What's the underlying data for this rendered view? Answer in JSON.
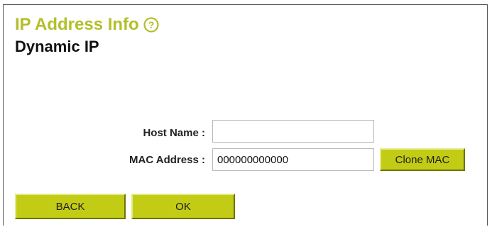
{
  "header": {
    "title": "IP Address Info",
    "help_icon": "question-circle-icon",
    "subtitle": "Dynamic IP"
  },
  "form": {
    "host_name": {
      "label": "Host Name :",
      "value": ""
    },
    "mac_address": {
      "label": "MAC Address :",
      "value": "000000000000"
    },
    "clone_mac_label": "Clone MAC"
  },
  "footer": {
    "back_label": "BACK",
    "ok_label": "OK"
  },
  "colors": {
    "title": "#b3bf2a",
    "button_bg": "#c3cc14",
    "frame_border": "#555555"
  }
}
